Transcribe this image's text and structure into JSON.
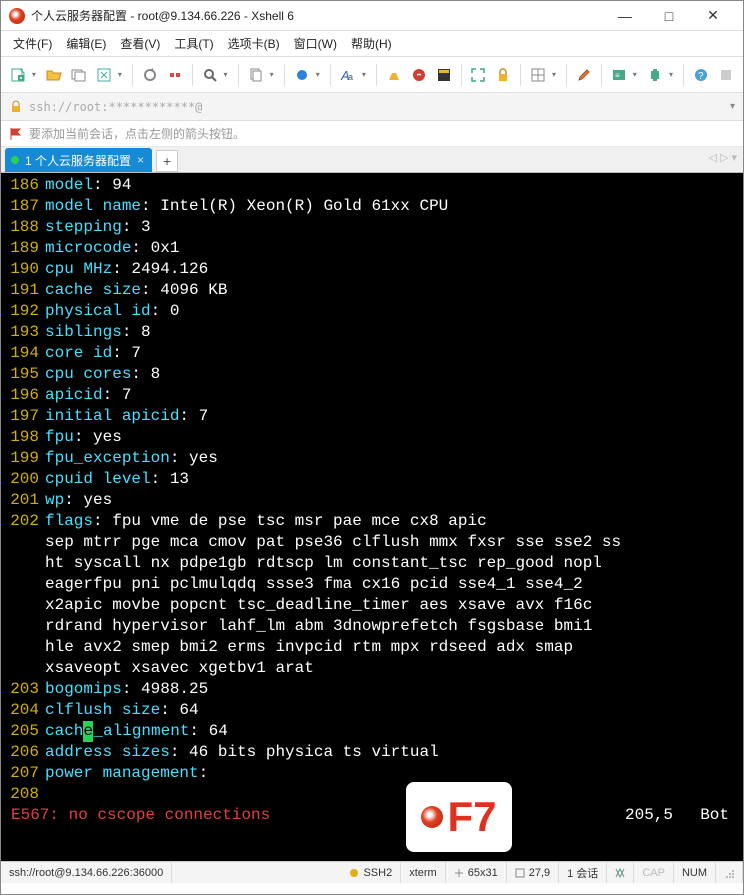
{
  "window": {
    "title": "个人云服务器配置 - root@9.134.66.226 - Xshell 6",
    "min": "—",
    "max": "□",
    "close": "✕"
  },
  "menu": {
    "file": "文件(F)",
    "edit": "编辑(E)",
    "view": "查看(V)",
    "tools": "工具(T)",
    "tabs": "选项卡(B)",
    "window": "窗口(W)",
    "help": "帮助(H)"
  },
  "addr": "ssh://root:************@",
  "hint": "要添加当前会话，点击左侧的箭头按钮。",
  "tab": {
    "label": "1 个人云服务器配置",
    "add": "+",
    "nav": "◁  ▷  ▾"
  },
  "lines": [
    {
      "n": "186",
      "k": "model",
      "v": "94"
    },
    {
      "n": "187",
      "k": "model name",
      "v": "Intel(R) Xeon(R) Gold 61xx CPU"
    },
    {
      "n": "188",
      "k": "stepping",
      "v": "3"
    },
    {
      "n": "189",
      "k": "microcode",
      "v": "0x1"
    },
    {
      "n": "190",
      "k": "cpu MHz",
      "v": "2494.126"
    },
    {
      "n": "191",
      "k": "cache size",
      "v": "4096 KB"
    },
    {
      "n": "192",
      "k": "physical id",
      "v": "0"
    },
    {
      "n": "193",
      "k": "siblings",
      "v": "8"
    },
    {
      "n": "194",
      "k": "core id",
      "v": "7"
    },
    {
      "n": "195",
      "k": "cpu cores",
      "v": "8"
    },
    {
      "n": "196",
      "k": "apicid",
      "v": "7"
    },
    {
      "n": "197",
      "k": "initial apicid",
      "v": "7"
    },
    {
      "n": "198",
      "k": "fpu",
      "v": "yes"
    },
    {
      "n": "199",
      "k": "fpu_exception",
      "v": "yes"
    },
    {
      "n": "200",
      "k": "cpuid level",
      "v": "13"
    },
    {
      "n": "201",
      "k": "wp",
      "v": "yes"
    }
  ],
  "flags_n": "202",
  "flags_k": "flags",
  "flags_first": "fpu vme de pse tsc msr pae mce cx8 apic",
  "flags_wrap": [
    " sep mtrr pge mca cmov pat pse36 clflush mmx fxsr sse sse2 ss",
    " ht syscall nx pdpe1gb rdtscp lm constant_tsc rep_good nopl",
    " eagerfpu pni pclmulqdq ssse3 fma cx16 pcid sse4_1 sse4_2",
    " x2apic movbe popcnt tsc_deadline_timer aes xsave avx f16c",
    " rdrand hypervisor lahf_lm abm 3dnowprefetch fsgsbase bmi1",
    " hle avx2 smep bmi2 erms invpcid rtm mpx rdseed adx smap",
    " xsaveopt xsavec xgetbv1 arat"
  ],
  "tail": [
    {
      "n": "203",
      "k": "bogomips",
      "v": "4988.25"
    },
    {
      "n": "204",
      "k": "clflush size",
      "v": "64"
    }
  ],
  "cursor_line": {
    "n": "205",
    "pre": "cach",
    "cur": "e",
    "post": "_alignment",
    "v": "64"
  },
  "tail2": [
    {
      "n": "206",
      "k": "address sizes",
      "v": "46 bits physica         ts virtual"
    },
    {
      "n": "207",
      "k": "power management",
      "v": "",
      "nocolon": false
    }
  ],
  "blank_n": "208",
  "errline": {
    "txt": "E567: no cscope connections",
    "pos": "205,5",
    "where": "Bot"
  },
  "overlay": "F7",
  "status": {
    "conn": "ssh://root@9.134.66.226:36000",
    "proto": "SSH2",
    "term": "xterm",
    "size": "65x31",
    "rc": "27,9",
    "sess": "1 会话",
    "cap": "CAP",
    "num": "NUM"
  }
}
